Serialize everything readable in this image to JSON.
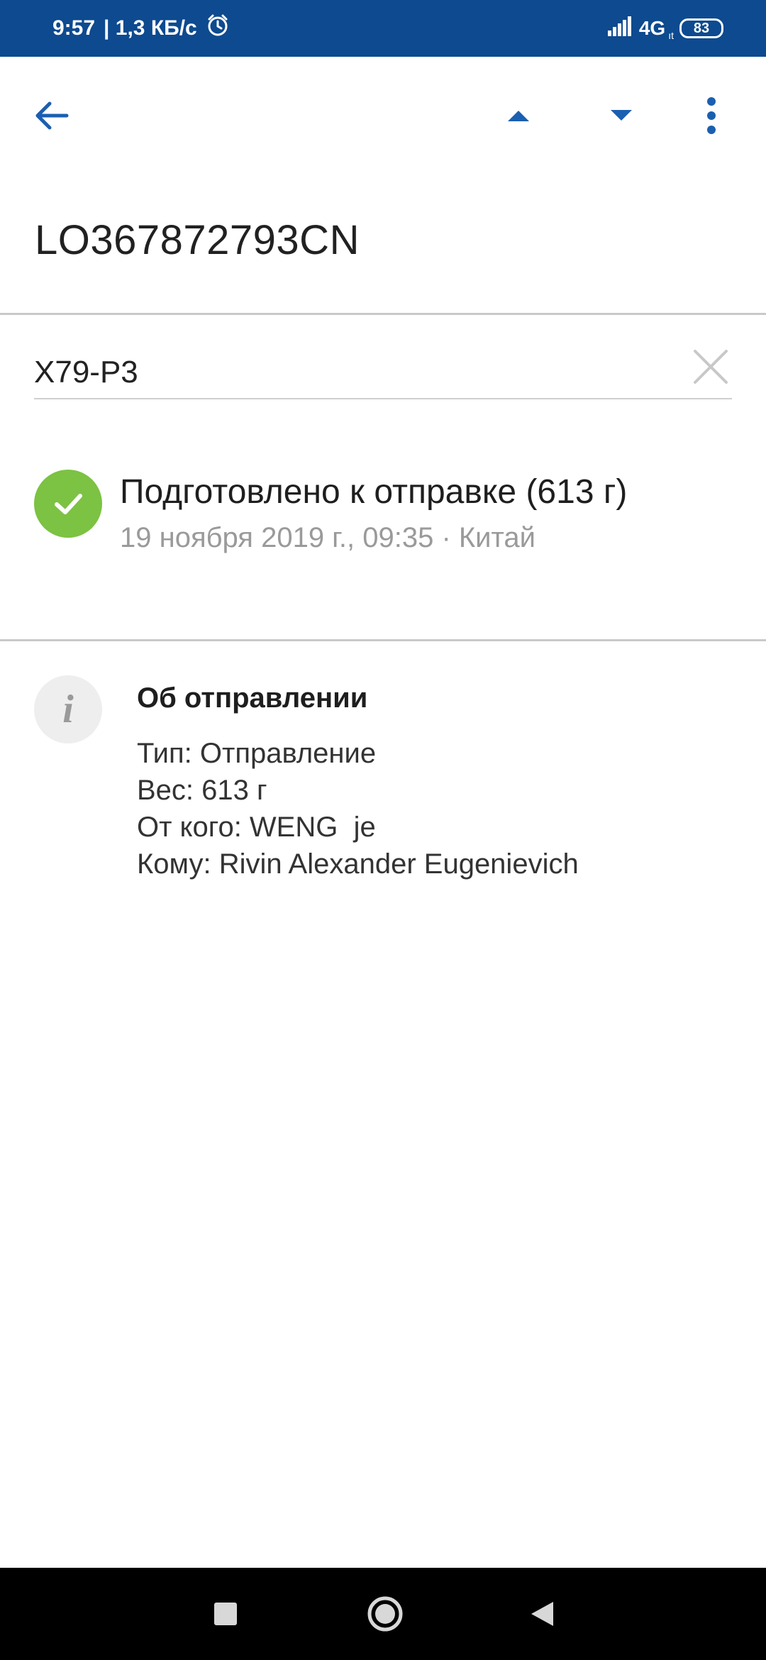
{
  "status_bar": {
    "time": "9:57",
    "net_speed": "| 1,3 КБ/с",
    "network": "4G",
    "network_sub": "ıt",
    "battery": "83",
    "icons": [
      "alarm-icon",
      "signal-icon",
      "battery-icon"
    ]
  },
  "app_bar": {
    "icons": [
      "arrow-back-icon",
      "caret-up-icon",
      "caret-down-icon",
      "more-vert-icon"
    ]
  },
  "tracking_number": "LO367872793CN",
  "name_field": {
    "value": "X79-P3"
  },
  "event": {
    "title": "Подготовлено к отправке (613 г)",
    "subtitle": "19 ноября 2019 г., 09:35 · Китай",
    "icon": "check-icon"
  },
  "info": {
    "icon_glyph": "i",
    "title": "Об отправлении",
    "lines": [
      "Тип: Отправление",
      "Вес: 613 г",
      "От кого: WENG  je",
      "Кому: Rivin Alexander Eugenievich"
    ]
  },
  "colors": {
    "status_bar_bg": "#0d4a8f",
    "accent": "#1b5fb0",
    "success": "#7cc243",
    "nav_bar_bg": "#000000"
  },
  "nav_bar": {
    "icons": [
      "recents-square-icon",
      "home-circle-icon",
      "back-triangle-icon"
    ]
  }
}
